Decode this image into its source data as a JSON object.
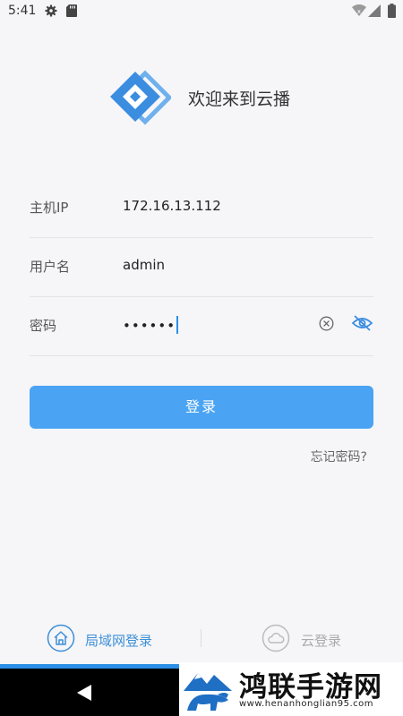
{
  "status_bar": {
    "time": "5:41",
    "icons": [
      "gear-icon",
      "sd-card-icon",
      "wifi-icon",
      "signal-icon",
      "battery-icon"
    ]
  },
  "header": {
    "welcome": "欢迎来到云播",
    "logo_icon": "diamond-logo-icon",
    "logo_color": "#3b8de0"
  },
  "form": {
    "host_label": "主机IP",
    "host_value": "172.16.13.112",
    "user_label": "用户名",
    "user_value": "admin",
    "password_label": "密码",
    "password_masked": "••••••",
    "clear_icon": "clear-circle-icon",
    "visibility_icon": "eye-hidden-icon"
  },
  "actions": {
    "login_label": "登录",
    "forgot_label": "忘记密码?"
  },
  "tabs": {
    "lan_label": "局域网登录",
    "cloud_label": "云登录",
    "active": "lan",
    "accent_color": "#2b8fe8"
  },
  "watermark": {
    "title": "鸿联手游网",
    "url": "www.henanhonglian95.com"
  }
}
